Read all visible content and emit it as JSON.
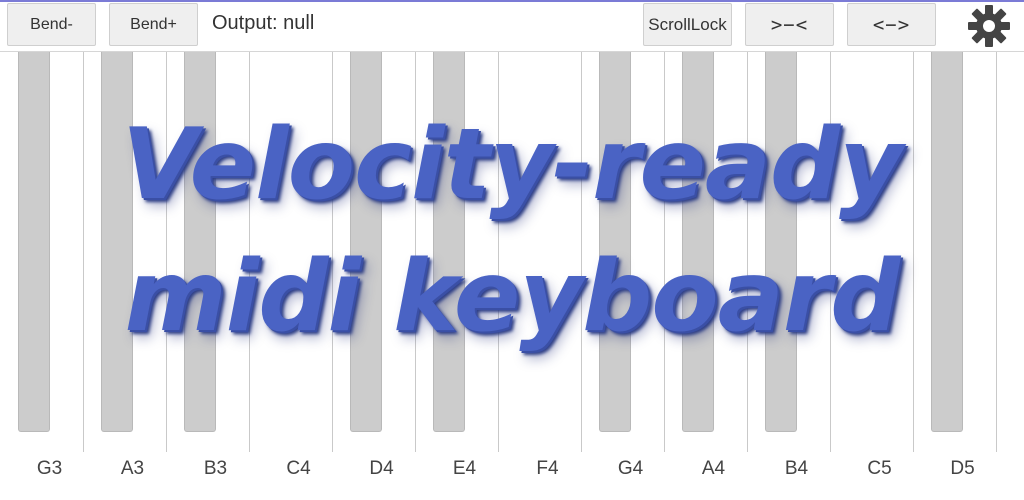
{
  "toolbar": {
    "bend_minus": "Bend-",
    "bend_plus": "Bend+",
    "output_text": "Output: null",
    "scroll_lock": "ScrollLock",
    "zoom_in": ">−<",
    "zoom_out": "<−>",
    "settings_icon": "gear-icon"
  },
  "keyboard": {
    "white_keys": [
      "G3",
      "A3",
      "B3",
      "C4",
      "D4",
      "E4",
      "F4",
      "G4",
      "A4",
      "B4",
      "C5",
      "D5"
    ],
    "has_black_key_before": [
      true,
      true,
      true,
      false,
      true,
      true,
      false,
      true,
      true,
      true,
      false,
      true
    ],
    "white_color": "#ffffff",
    "black_key_color": "#cccccc"
  },
  "promo": {
    "line1": "Velocity-ready",
    "line2": "midi keyboard",
    "color": "#4a63c4"
  }
}
